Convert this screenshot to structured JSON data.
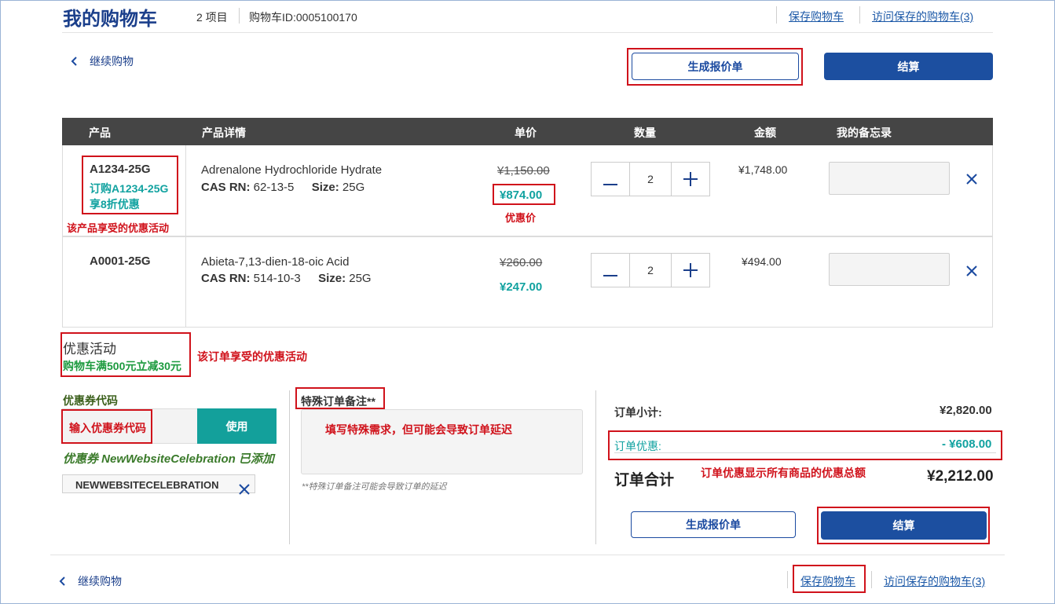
{
  "header": {
    "title": "我的购物车",
    "item_count": "2 项目",
    "cart_id": "购物车ID:0005100170",
    "save_cart": "保存购物车",
    "visit_saved": "访问保存的购物车(3)"
  },
  "actions": {
    "continue_shopping": "继续购物",
    "generate_quote": "生成报价单",
    "checkout": "结算"
  },
  "table": {
    "headers": [
      "产品",
      "产品详情",
      "单价",
      "数量",
      "金额",
      "我的备忘录"
    ],
    "rows": [
      {
        "sku": "A1234-25G",
        "promo_line1": "订购A1234-25G",
        "promo_line2": "享8折优惠",
        "name": "Adrenalone Hydrochloride Hydrate",
        "cas_label": "CAS RN:",
        "cas": "62-13-5",
        "size_label": "Size:",
        "size": "25G",
        "old_price": "¥1,150.00",
        "price": "¥874.00",
        "qty": "2",
        "amount": "¥1,748.00"
      },
      {
        "sku": "A0001-25G",
        "name": "Abieta-7,13-dien-18-oic Acid",
        "cas_label": "CAS RN:",
        "cas": "514-10-3",
        "size_label": "Size:",
        "size": "25G",
        "old_price": "¥260.00",
        "price": "¥247.00",
        "qty": "2",
        "amount": "¥494.00"
      }
    ]
  },
  "promotion": {
    "title": "优惠活动",
    "detail": "购物车满500元立减30元"
  },
  "coupon": {
    "label": "优惠券代码",
    "placeholder": "输入优惠券代码",
    "apply": "使用",
    "added_msg": "优惠券 NewWebsiteCelebration 已添加",
    "code": "NEWWEBSITECELEBRATION"
  },
  "special_notes": {
    "label": "特殊订单备注**",
    "hint": "**特殊订单备注可能会导致订单的延迟"
  },
  "summary": {
    "subtotal_label": "订单小计:",
    "subtotal": "¥2,820.00",
    "discount_label": "订单优惠:",
    "discount": "- ¥608.00",
    "total_label": "订单合计",
    "total": "¥2,212.00"
  },
  "annotations": {
    "product_promo": "该产品享受的优惠活动",
    "discount_price": "优惠价",
    "order_promo": "该订单享受的优惠活动",
    "notes_hint": "填写特殊需求，但可能会导致订单延迟",
    "discount_total": "订单优惠显示所有商品的优惠总额"
  },
  "icons": {
    "back": "chevron-left-icon",
    "minus": "minus-icon",
    "plus": "plus-icon",
    "remove": "close-icon"
  },
  "colors": {
    "brand_navy": "#1b3f8b",
    "button_blue": "#1c4fa0",
    "teal": "#11a2a0",
    "annotation_red": "#d0121b",
    "promo_green": "#1c9a3e"
  }
}
